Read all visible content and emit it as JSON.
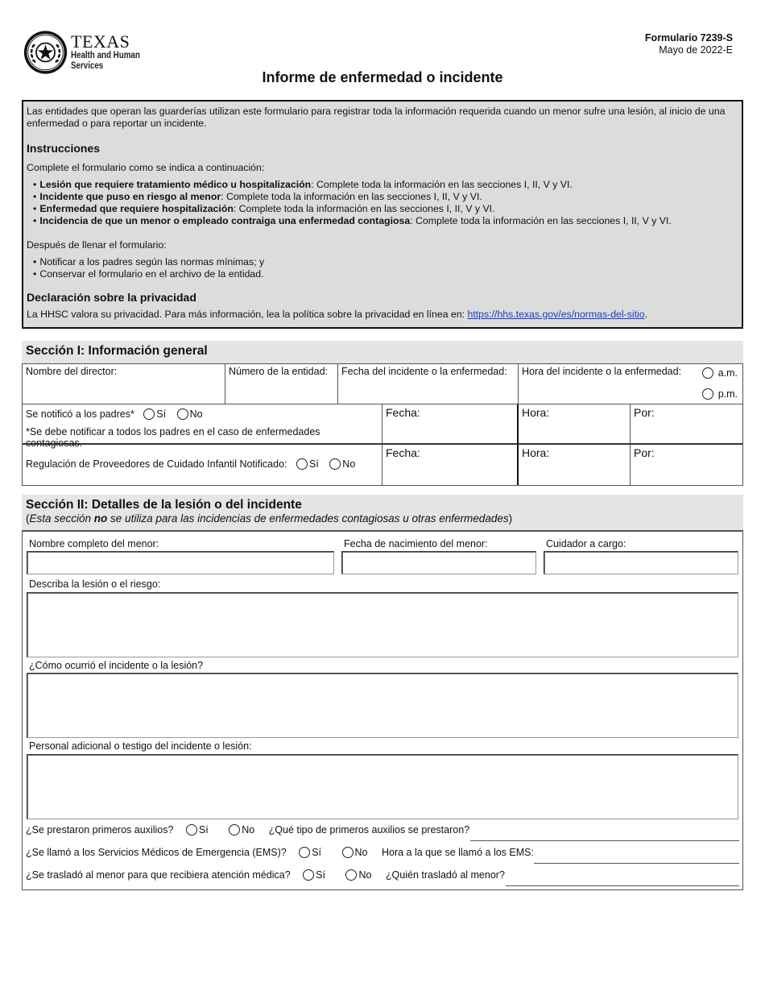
{
  "header": {
    "logo": {
      "icon": "texas-seal-icon",
      "line1": "TEXAS",
      "line2": "Health and Human",
      "line3": "Services"
    },
    "form_number": "Formulario 7239-S",
    "form_date": "Mayo de 2022-E",
    "title": "Informe de enfermedad o incidente"
  },
  "intro": {
    "description": "Las entidades que operan las guarderías utilizan este formulario para registrar toda la información requerida cuando un menor sufre una lesión, al inicio de una enfermedad o para reportar un incidente.",
    "instructions_heading": "Instrucciones",
    "instructions_lead": "Complete el formulario como se indica a continuación:",
    "instructions": [
      {
        "bold": "Lesión que requiere tratamiento médico u hospitalización",
        "text": ": Complete toda la información en las secciones I, II, V y VI."
      },
      {
        "bold": "Incidente que puso en riesgo al menor",
        "text": ": Complete toda la información en las secciones I, II, V y VI."
      },
      {
        "bold": "Enfermedad que requiere hospitalización",
        "text": ": Complete toda la información en las secciones I, II, V y VI."
      },
      {
        "bold": "Incidencia de que un menor o empleado contraiga una enfermedad contagiosa",
        "text": ": Complete toda la información en las secciones I, II, V y VI."
      }
    ],
    "after_lead": "Después de llenar el formulario:",
    "after_items": [
      "Notificar a los padres según las normas mínimas; y",
      "Conservar el formulario en el archivo de la entidad."
    ],
    "privacy_heading": "Declaración sobre la privacidad",
    "privacy_text": "La HHSC valora su privacidad. Para más información, lea la política sobre la privacidad en línea en: ",
    "privacy_link": "https://hhs.texas.gov/es/normas-del-sitio",
    "privacy_end": "."
  },
  "section1": {
    "title": "Sección I: Información general",
    "director_label": "Nombre del director:",
    "entity_number_label": "Número de la entidad:",
    "incident_date_label": "Fecha del incidente o la enfermedad:",
    "incident_time_label": "Hora del incidente o la enfermedad:",
    "am_label": "a.m.",
    "pm_label": "p.m.",
    "parents_notified_label": "Se notificó a los padres*",
    "yes_label": "Sí",
    "no_label": "No",
    "parents_note": "*Se debe notificar a todos los padres en el caso de enfermedades contagiosas.",
    "ccr_notified_label": "Regulación de Proveedores de Cuidado Infantil Notificado:",
    "date_label": "Fecha:",
    "time_label": "Hora:",
    "by_label": "Por:"
  },
  "section2": {
    "title": "Sección II: Detalles de la lesión o del incidente",
    "subtitle_open": "(",
    "subtitle_italic1": "Esta sección  ",
    "subtitle_bold": "no",
    "subtitle_italic2": " se utiliza para las incidencias de enfermedades contagiosas u otras enfermedades",
    "subtitle_close": ")",
    "child_name_label": "Nombre completo del menor:",
    "child_dob_label": "Fecha de nacimiento del menor:",
    "caregiver_label": "Cuidador a cargo:",
    "describe_label": "Describa la lesión o el riesgo:",
    "how_label": "¿Cómo ocurrió el incidente o la lesión?",
    "witness_label": "Personal adicional o testigo del incidente o lesión:",
    "first_aid_q": "¿Se prestaron primeros auxilios?",
    "first_aid_type_q": "¿Qué tipo de primeros auxilios se prestaron?",
    "ems_q": "¿Se llamó a los Servicios Médicos de Emergencia (EMS)?",
    "ems_time_q": "Hora a la que se llamó a los EMS:",
    "transport_q": "¿Se trasladó al menor para que  recibiera atención médica?",
    "transport_who_q": "¿Quién trasladó al menor?",
    "yes_label": "Sí",
    "no_label": "No"
  }
}
